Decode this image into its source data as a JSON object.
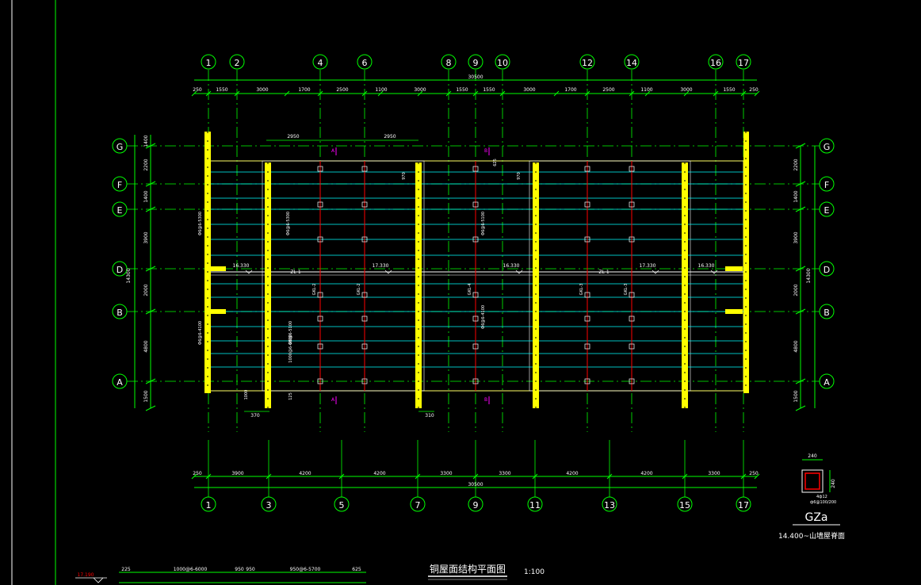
{
  "colors": {
    "background": "#000000",
    "grid_line": "#00ff00",
    "dimension": "#00ff00",
    "text": "#ffffff",
    "beam_cyan": "#00ffff",
    "beam_red": "#ff0000",
    "column_yellow": "#ffff00",
    "section_magenta": "#ff00ff",
    "border_green": "#00ff00",
    "outline_yellow": "#ffff66"
  },
  "grid_axes_top": [
    "1",
    "2",
    "4",
    "6",
    "8",
    "9",
    "10",
    "12",
    "14",
    "16",
    "17"
  ],
  "grid_axes_bottom": [
    "1",
    "3",
    "5",
    "7",
    "9",
    "11",
    "13",
    "15",
    "17"
  ],
  "grid_axes_rows": [
    "G",
    "F",
    "E",
    "D",
    "B",
    "A"
  ],
  "top_dims": {
    "total": "30500",
    "segments": [
      "250",
      "1550",
      "3000",
      "1700",
      "2500",
      "1100",
      "3000",
      "1550",
      "1550",
      "3000",
      "1700",
      "2500",
      "1100",
      "3000",
      "1550",
      "250"
    ]
  },
  "bottom_dims": {
    "total": "30500",
    "segments": [
      "250",
      "3900",
      "4200",
      "4200",
      "3300",
      "3300",
      "4200",
      "4200",
      "3300",
      "250"
    ]
  },
  "left_dims": [
    "1400",
    "2200",
    "1400",
    "3900",
    "2000",
    "4800",
    "1500"
  ],
  "left_total": "14300",
  "right_dims": [
    "2200",
    "1400",
    "3900",
    "2000",
    "4800",
    "1500"
  ],
  "right_total": "14300",
  "inner_dims_top": [
    "2950",
    "2950"
  ],
  "inner_labels": {
    "dim_970_a": "970",
    "dim_970_b": "970",
    "dim_625": "625",
    "dim_310": "310",
    "dim_370": "370",
    "dim_1000": "1000",
    "dim_125": "125"
  },
  "vertical_notes": [
    "Ф6@6-5300",
    "Ф6@6-5300",
    "Ф6@6-5100",
    "Ф6@6-4100",
    "Ф6@6-5100",
    "Ф6@6-4100",
    "1000@6-6800"
  ],
  "level_marks": [
    "16.330",
    "17.330",
    "16.330",
    "17.330",
    "16.330"
  ],
  "beam_labels": {
    "zl1_left": "ZL-1",
    "zl1_right": "ZL-1",
    "gkl_1": "GKL-2",
    "gkl_2": "GKL-2",
    "gkl_3": "GKL-4",
    "gkl_4": "GKL-3",
    "gkl_5": "GKL-3"
  },
  "section_marks": [
    "A",
    "B",
    "A",
    "B"
  ],
  "detail": {
    "title": "GZa",
    "note": "14.400~山墙屋脊面",
    "dim_w": "240",
    "dim_h": "240",
    "rebar_1": "4ф12",
    "rebar_2": "ф6@100/200"
  },
  "drawing_title": "铜屋面结构平面图",
  "drawing_scale": "1:100",
  "bottom_strip": {
    "elev": "17.190",
    "d1": "225",
    "d2": "1000@6-6000",
    "d3": "950",
    "d4": "950",
    "d5": "950@6-5700",
    "d6": "625"
  }
}
